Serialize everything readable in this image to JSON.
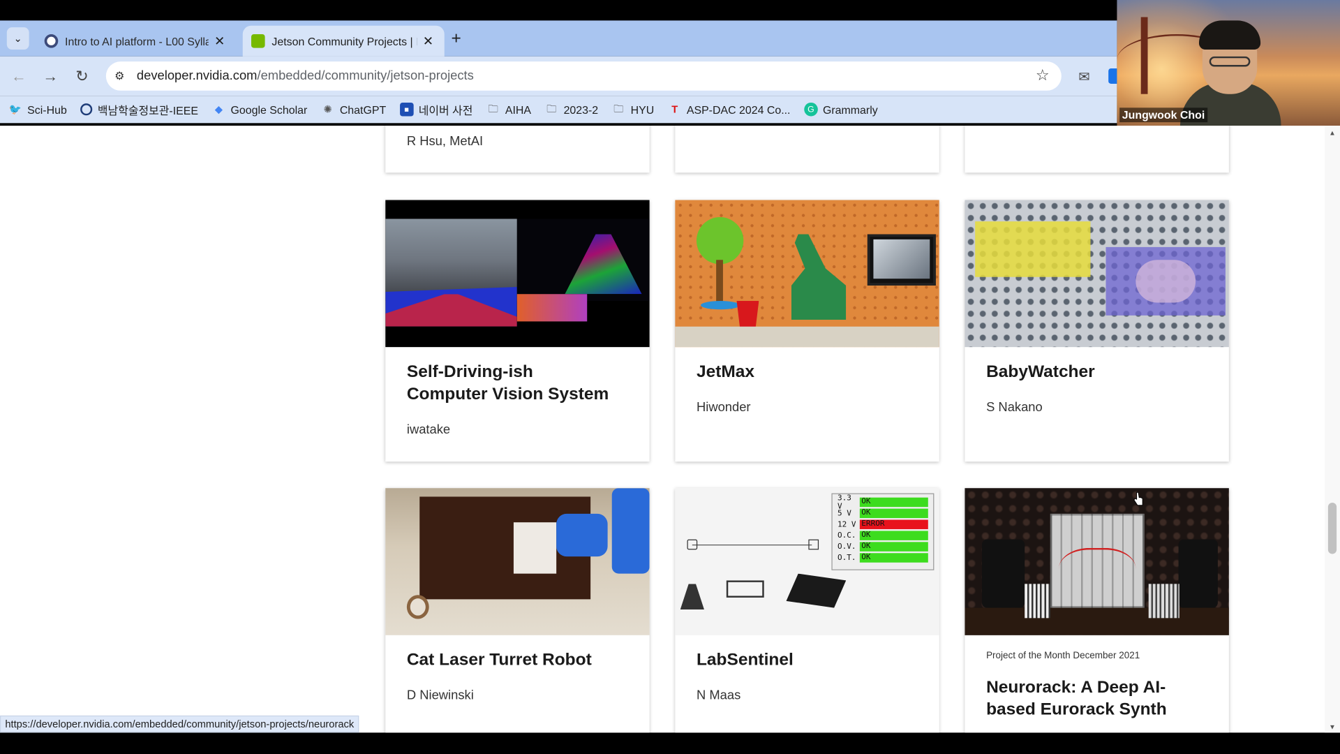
{
  "browser": {
    "tabs": [
      {
        "title": "Intro to AI platform - L00 Sylla",
        "active": false
      },
      {
        "title": "Jetson Community Projects | N",
        "active": true
      }
    ],
    "new_tab_label": "+",
    "url_domain": "developer.nvidia.com",
    "url_path": "/embedded/community/jetson-projects",
    "bookmarks": [
      {
        "label": "Sci-Hub",
        "icon": "sci-hub-icon"
      },
      {
        "label": "백남학술정보관-IEEE",
        "icon": "library-icon"
      },
      {
        "label": "Google Scholar",
        "icon": "scholar-icon"
      },
      {
        "label": "ChatGPT",
        "icon": "chatgpt-icon"
      },
      {
        "label": "네이버 사전",
        "icon": "naver-dict-icon"
      },
      {
        "label": "AIHA",
        "icon": "folder-icon"
      },
      {
        "label": "2023-2",
        "icon": "folder-icon"
      },
      {
        "label": "HYU",
        "icon": "folder-icon"
      },
      {
        "label": "ASP-DAC 2024 Co...",
        "icon": "aspdac-icon"
      },
      {
        "label": "Grammarly",
        "icon": "grammarly-icon"
      }
    ]
  },
  "video": {
    "participant_name": "Jungwook Choi"
  },
  "cards": {
    "top_author": "R Hsu, MetAI",
    "row1": [
      {
        "title_line1": "Self-Driving-ish",
        "title_line2": "Computer Vision System",
        "author": "iwatake"
      },
      {
        "title_line1": "JetMax",
        "author": "Hiwonder"
      },
      {
        "title_line1": "BabyWatcher",
        "author": "S Nakano"
      }
    ],
    "row2": [
      {
        "title_line1": "Cat Laser Turret Robot",
        "author": "D Niewinski"
      },
      {
        "title_line1": "LabSentinel",
        "author": "N Maas"
      },
      {
        "tag": "Project of the Month December 2021",
        "title_line1": "Neurorack: A Deep AI-",
        "title_line2": "based Eurorack Synth"
      }
    ],
    "labsentinel_status": [
      {
        "label": "3.3 V",
        "status": "OK"
      },
      {
        "label": "5 V",
        "status": "OK"
      },
      {
        "label": "12 V",
        "status": "ERROR"
      },
      {
        "label": "O.C.",
        "status": "OK"
      },
      {
        "label": "O.V.",
        "status": "OK"
      },
      {
        "label": "O.T.",
        "status": "OK"
      }
    ]
  },
  "status_url": "https://developer.nvidia.com/embedded/community/jetson-projects/neurorack",
  "colors": {
    "tabstrip": "#a9c5f0",
    "toolbar": "#d7e4f8",
    "ok": "#3ddc1e",
    "error": "#e8121c"
  }
}
